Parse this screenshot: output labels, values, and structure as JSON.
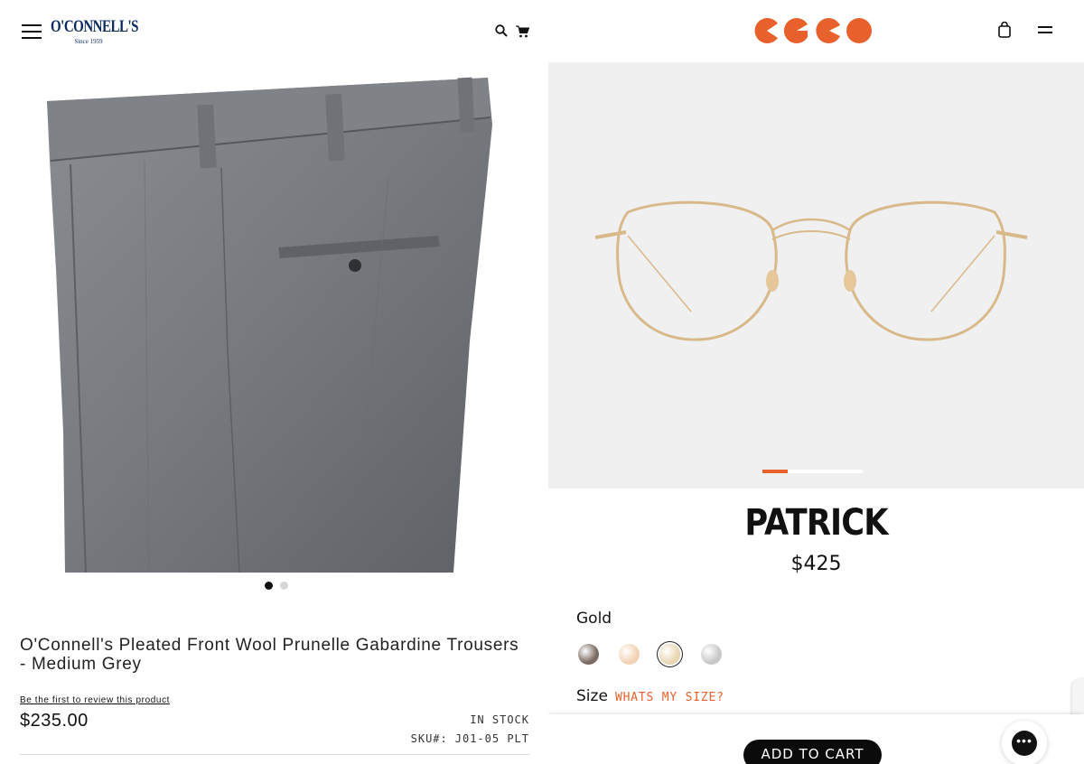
{
  "left": {
    "brand": {
      "name": "O'CONNELL'S",
      "since": "Since 1959",
      "color": "#0c2a5e"
    },
    "icons": {
      "menu": "hamburger-icon",
      "search": "search-icon",
      "cart": "cart-icon"
    },
    "gallery": {
      "slide_count": 2,
      "active_slide": 1
    },
    "product": {
      "title": "O'Connell's Pleated Front Wool Prunelle Gabardine Trousers - Medium Grey",
      "review_link": "Be the first to review this product",
      "price": "$235.00",
      "stock": "IN STOCK",
      "sku_label": "SKU#:",
      "sku_value": "J01-05 PLT"
    }
  },
  "right": {
    "brand": {
      "accent": "#e8612c"
    },
    "icons": {
      "bag": "shopping-bag-icon",
      "menu": "menu-icon",
      "chat": "chat-icon"
    },
    "gallery": {
      "progress": 0.25
    },
    "product": {
      "name": "PATRICK",
      "price": "$425",
      "color_label": "Gold",
      "swatches": [
        {
          "name": "brown",
          "color": "#7a6a60"
        },
        {
          "name": "rose-gold",
          "color": "#f2d2b4"
        },
        {
          "name": "gold",
          "color": "#e9d7b3",
          "selected": true
        },
        {
          "name": "silver",
          "color": "#c8c8c8"
        }
      ],
      "size_label": "Size",
      "size_link": "WHATS MY SIZE?",
      "add_to_cart": "ADD TO CART"
    }
  }
}
